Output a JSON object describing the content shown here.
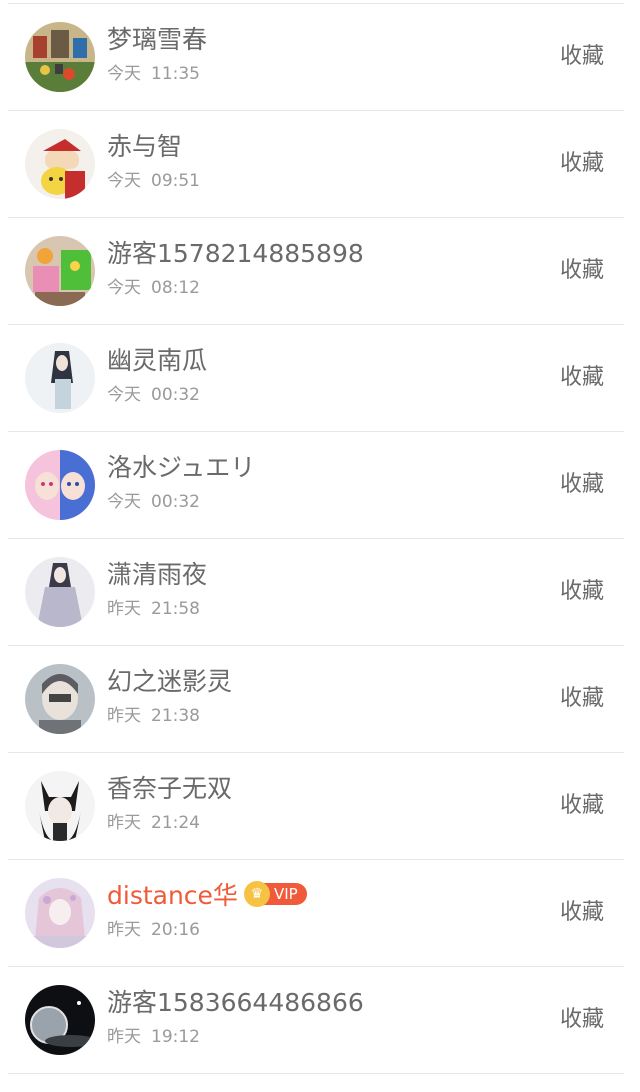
{
  "fav_label": "收藏",
  "vip_label": "VIP",
  "colors": {
    "vip_name": "#f05a3a",
    "badge_crown": "#f6c244",
    "badge_pill": "#f05a3a",
    "divider": "#e6e6e6"
  },
  "items": [
    {
      "name": "梦璃雪春",
      "day": "今天",
      "time": "11:35",
      "avatar": "avatar-lego-scene"
    },
    {
      "name": "赤与智",
      "day": "今天",
      "time": "09:51",
      "avatar": "avatar-pikachu-trainer"
    },
    {
      "name": "游客1578214885898",
      "day": "今天",
      "time": "08:12",
      "avatar": "avatar-colorful-toys"
    },
    {
      "name": "幽灵南瓜",
      "day": "今天",
      "time": "00:32",
      "avatar": "avatar-girl-snow"
    },
    {
      "name": "洛水ジュエリ",
      "day": "今天",
      "time": "00:32",
      "avatar": "avatar-anime-duo"
    },
    {
      "name": "潇清雨夜",
      "day": "昨天",
      "time": "21:58",
      "avatar": "avatar-ink-figure"
    },
    {
      "name": "幻之迷影灵",
      "day": "昨天",
      "time": "21:38",
      "avatar": "avatar-masked-character"
    },
    {
      "name": "香奈子无双",
      "day": "昨天",
      "time": "21:24",
      "avatar": "avatar-cat-ear-girl"
    },
    {
      "name": "distance华",
      "day": "昨天",
      "time": "20:16",
      "avatar": "avatar-pink-hair-girl",
      "vip": true
    },
    {
      "name": "游客1583664486866",
      "day": "昨天",
      "time": "19:12",
      "avatar": "avatar-planet"
    }
  ]
}
